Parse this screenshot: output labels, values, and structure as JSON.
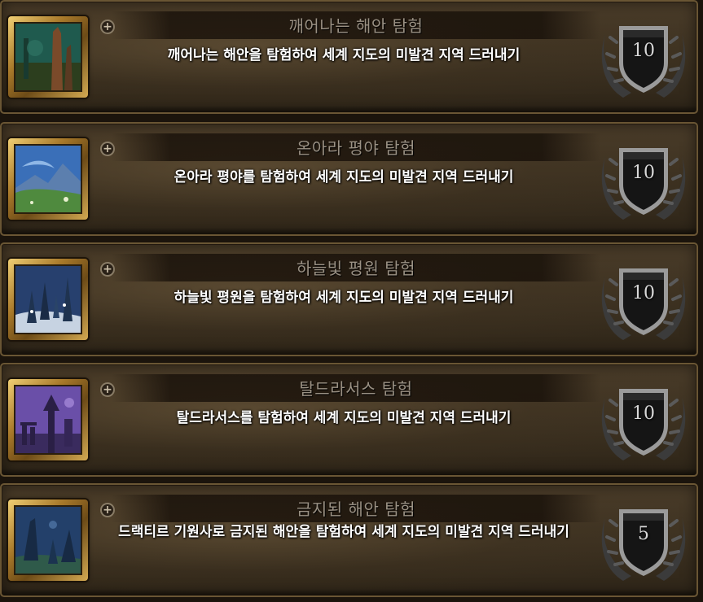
{
  "achievements": [
    {
      "title": "깨어나는 해안 탐험",
      "description": "깨어나는 해안을 탐험하여 세계 지도의 미발견 지역 드러내기",
      "points": "10",
      "icon": "waking-shores-icon",
      "colors": {
        "sky": "#1f5a4e",
        "ground": "#2c3e1e",
        "accent": "#7a4a2a"
      }
    },
    {
      "title": "온아라 평야 탐험",
      "description": "온아라 평야를 탐험하여 세계 지도의 미발견 지역 드러내기",
      "points": "10",
      "icon": "ohnahran-plains-icon",
      "colors": {
        "sky": "#3a6fb8",
        "ground": "#4f8a3e",
        "accent": "#8fb7e6"
      }
    },
    {
      "title": "하늘빛 평원 탐험",
      "description": "하늘빛 평원을 탐험하여 세계 지도의 미발견 지역 드러내기",
      "points": "10",
      "icon": "azure-span-icon",
      "colors": {
        "sky": "#27406e",
        "ground": "#c7d3e2",
        "accent": "#1f3350"
      }
    },
    {
      "title": "탈드라서스 탐험",
      "description": "탈드라서스를 탐험하여 세계 지도의 미발견 지역 드러내기",
      "points": "10",
      "icon": "thaldraszus-icon",
      "colors": {
        "sky": "#6a4fa8",
        "ground": "#3a2b5e",
        "accent": "#2a1f45"
      }
    },
    {
      "title": "금지된 해안 탐험",
      "description": "드랙티르 기원사로 금지된 해안을 탐험하여 세계 지도의 미발견 지역 드러내기",
      "points": "5",
      "icon": "forbidden-reach-icon",
      "colors": {
        "sky": "#23406a",
        "ground": "#2f5a4a",
        "accent": "#172a44"
      }
    }
  ]
}
